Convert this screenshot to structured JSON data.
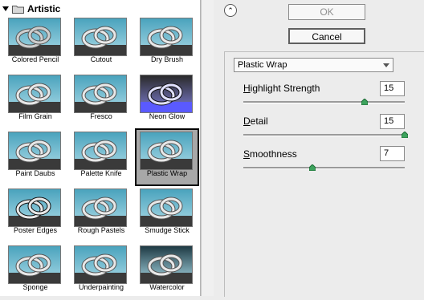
{
  "gallery": {
    "category": "Artistic",
    "filters": [
      {
        "label": "Colored Pencil",
        "style": "pencil"
      },
      {
        "label": "Cutout",
        "style": "cutout"
      },
      {
        "label": "Dry Brush",
        "style": "drybrush"
      },
      {
        "label": "Film Grain",
        "style": "grain"
      },
      {
        "label": "Fresco",
        "style": "fresco"
      },
      {
        "label": "Neon Glow",
        "style": "neon"
      },
      {
        "label": "Paint Daubs",
        "style": "daubs"
      },
      {
        "label": "Palette Knife",
        "style": "knife"
      },
      {
        "label": "Plastic Wrap",
        "style": "plastic",
        "selected": true
      },
      {
        "label": "Poster Edges",
        "style": "poster"
      },
      {
        "label": "Rough Pastels",
        "style": "pastel"
      },
      {
        "label": "Smudge Stick",
        "style": "smudge"
      },
      {
        "label": "Sponge",
        "style": "sponge"
      },
      {
        "label": "Underpainting",
        "style": "under"
      },
      {
        "label": "Watercolor",
        "style": "water"
      }
    ]
  },
  "buttons": {
    "ok": "OK",
    "cancel": "Cancel"
  },
  "filter_select": {
    "value": "Plastic Wrap"
  },
  "params": {
    "highlight": {
      "mnemonic": "H",
      "label_rest": "ighlight Strength",
      "value": "15",
      "level": 0.75
    },
    "detail": {
      "mnemonic": "D",
      "label_rest": "etail",
      "value": "15",
      "level": 1.0
    },
    "smoothness": {
      "mnemonic": "S",
      "label_rest": "moothness",
      "value": "7",
      "level": 0.43
    }
  },
  "colors": {
    "sky": "#4aa3bd",
    "sky_light": "#a9d9e6",
    "ground": "#3a3a3a",
    "selected_bg": "#a8a8a8"
  }
}
